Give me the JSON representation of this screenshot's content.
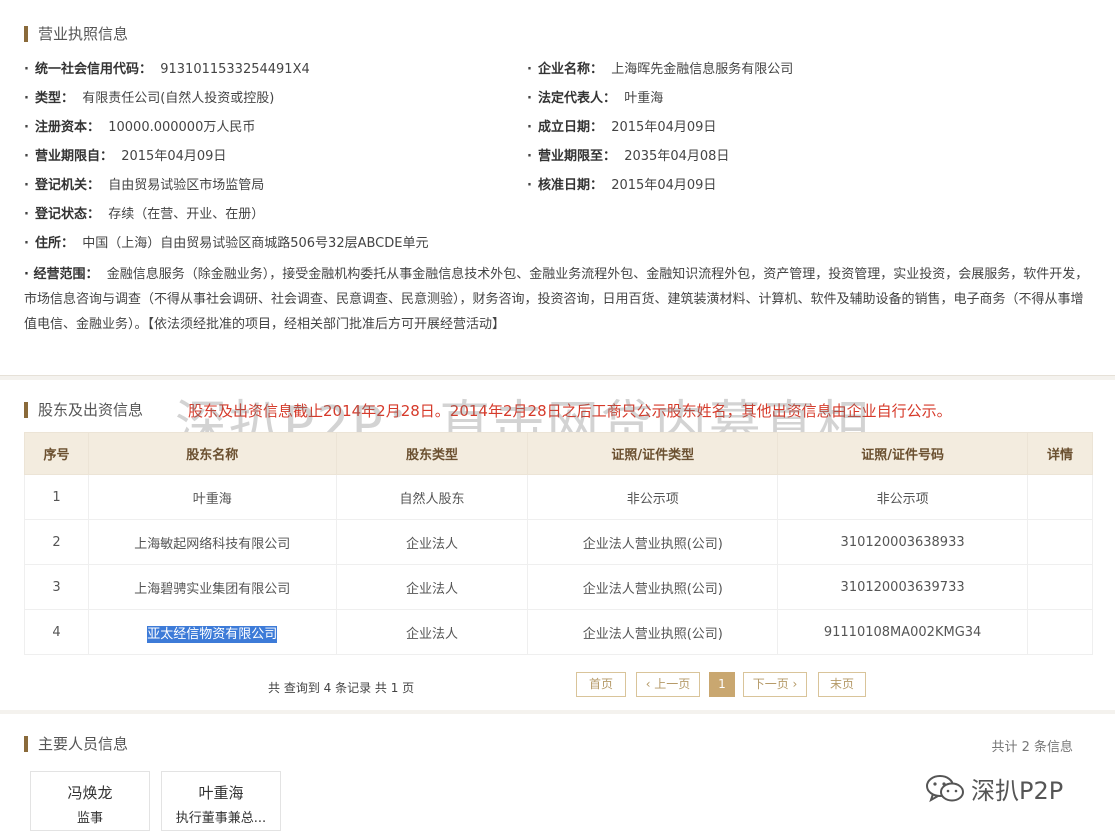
{
  "license": {
    "title": "营业执照信息",
    "credit_code_label": "统一社会信用代码：",
    "credit_code": "9131011533254491X4",
    "company_name_label": "企业名称：",
    "company_name": "上海晖先金融信息服务有限公司",
    "type_label": "类型：",
    "type": "有限责任公司(自然人投资或控股)",
    "legal_rep_label": "法定代表人：",
    "legal_rep": "叶重海",
    "capital_label": "注册资本：",
    "capital": "10000.000000万人民币",
    "founded_label": "成立日期：",
    "founded": "2015年04月09日",
    "term_from_label": "营业期限自：",
    "term_from": "2015年04月09日",
    "term_to_label": "营业期限至：",
    "term_to": "2035年04月08日",
    "authority_label": "登记机关：",
    "authority": "自由贸易试验区市场监管局",
    "approved_label": "核准日期：",
    "approved": "2015年04月09日",
    "status_label": "登记状态：",
    "status": "存续（在营、开业、在册）",
    "address_label": "住所：",
    "address": "中国（上海）自由贸易试验区商城路506号32层ABCDE单元",
    "scope_label": "经营范围：",
    "scope": "金融信息服务（除金融业务），接受金融机构委托从事金融信息技术外包、金融业务流程外包、金融知识流程外包，资产管理，投资管理，实业投资，会展服务，软件开发，市场信息咨询与调查（不得从事社会调研、社会调查、民意调查、民意测验），财务咨询，投资咨询，日用百货、建筑装潢材料、计算机、软件及辅助设备的销售，电子商务（不得从事增值电信、金融业务）。【依法须经批准的项目，经相关部门批准后方可开展经营活动】"
  },
  "shareholders": {
    "title": "股东及出资信息",
    "notice": "股东及出资信息截止2014年2月28日。2014年2月28日之后工商只公示股东姓名，其他出资信息由企业自行公示。",
    "watermark": "深扒P2P：直击网贷内幕真相",
    "headers": [
      "序号",
      "股东名称",
      "股东类型",
      "证照/证件类型",
      "证照/证件号码",
      "详情"
    ],
    "rows": [
      [
        "1",
        "叶重海",
        "自然人股东",
        "非公示项",
        "非公示项",
        ""
      ],
      [
        "2",
        "上海敏起网络科技有限公司",
        "企业法人",
        "企业法人营业执照(公司)",
        "310120003638933",
        ""
      ],
      [
        "3",
        "上海碧骋实业集团有限公司",
        "企业法人",
        "企业法人营业执照(公司)",
        "310120003639733",
        ""
      ],
      [
        "4",
        "亚太经信物资有限公司",
        "企业法人",
        "企业法人营业执照(公司)",
        "91110108MA002KMG34",
        ""
      ]
    ],
    "pagination": {
      "summary": "共 查询到 4 条记录 共 1 页",
      "first": "首页",
      "prev": "‹ 上一页",
      "current": "1",
      "next": "下一页 ›",
      "last": "末页"
    }
  },
  "personnel": {
    "title": "主要人员信息",
    "count": "共计 2 条信息",
    "people": [
      {
        "name": "冯焕龙",
        "role": "监事"
      },
      {
        "name": "叶重海",
        "role": "执行董事兼总..."
      }
    ]
  },
  "brand": {
    "text": "深扒P2P",
    "icon": "wechat-icon"
  },
  "colors": {
    "accent": "#8a6a3a",
    "notice": "#d63a2a",
    "highlight": "#3d7bd8",
    "header_bg": "#f3ecdf"
  }
}
